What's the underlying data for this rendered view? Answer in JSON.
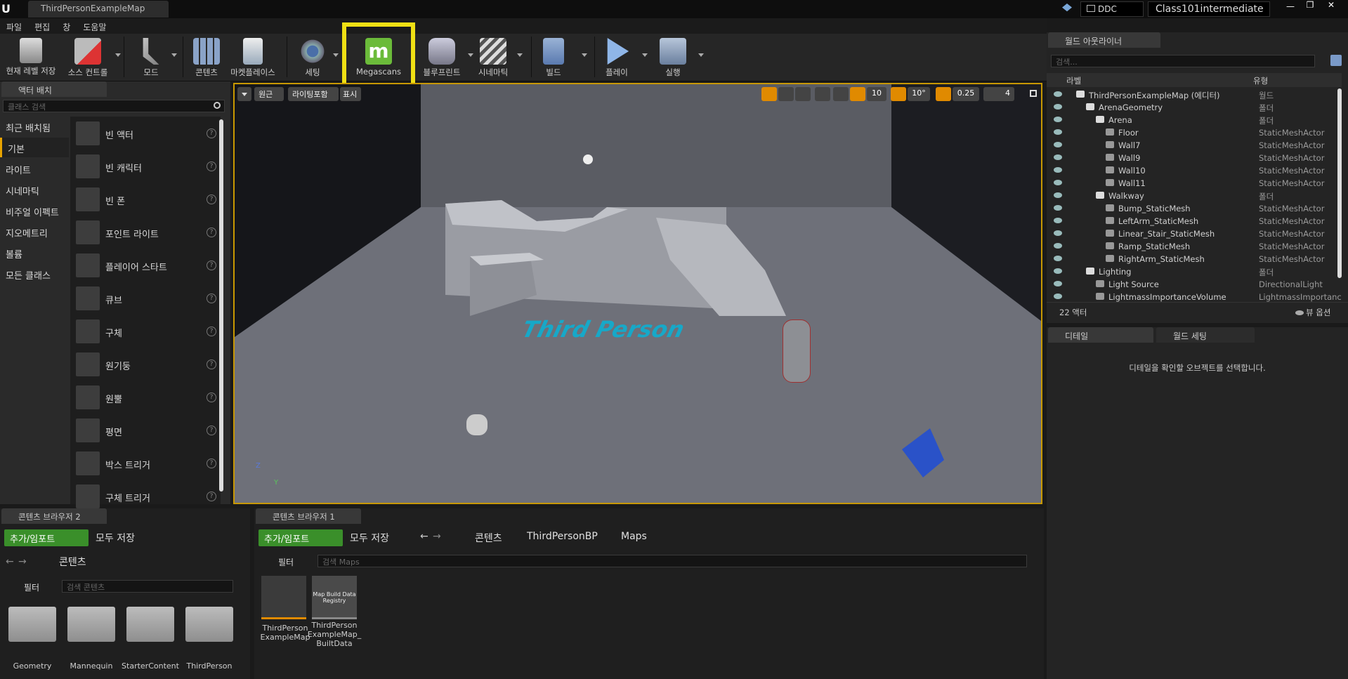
{
  "window": {
    "tab_title": "ThirdPersonExampleMap",
    "ddc_label": "DDC",
    "project_name": "Class101intermediate",
    "controls": [
      "—",
      "❐",
      "✕"
    ]
  },
  "menu": [
    "파일",
    "편집",
    "창",
    "도움말"
  ],
  "toolbar": {
    "items": [
      {
        "label": "현재 레벨 저장",
        "icon": "save-icon"
      },
      {
        "label": "소스 컨트롤",
        "icon": "source-control-icon"
      },
      {
        "label": "모드",
        "icon": "modes-icon"
      },
      {
        "label": "콘텐츠",
        "icon": "content-icon"
      },
      {
        "label": "마켓플레이스",
        "icon": "marketplace-icon"
      },
      {
        "label": "세팅",
        "icon": "settings-icon"
      },
      {
        "label": "Megascans",
        "icon": "megascans-icon"
      },
      {
        "label": "블루프린트",
        "icon": "blueprint-icon"
      },
      {
        "label": "시네마틱",
        "icon": "cinematics-icon"
      },
      {
        "label": "빌드",
        "icon": "build-icon"
      },
      {
        "label": "플레이",
        "icon": "play-icon"
      },
      {
        "label": "실행",
        "icon": "launch-icon"
      }
    ],
    "highlight_color": "#f0e014"
  },
  "place_actors": {
    "tab_label": "액터 배치",
    "search_placeholder": "클래스 검색",
    "categories": [
      "최근 배치됨",
      "기본",
      "라이트",
      "시네마틱",
      "비주얼 이펙트",
      "지오메트리",
      "볼륨",
      "모든 클래스"
    ],
    "selected_category": "기본",
    "items": [
      "빈 액터",
      "빈 캐릭터",
      "빈 폰",
      "포인트 라이트",
      "플레이어 스타트",
      "큐브",
      "구체",
      "원기둥",
      "원뿔",
      "평면",
      "박스 트리거",
      "구체 트리거"
    ]
  },
  "viewport": {
    "perspective_label": "원근",
    "lighting_label": "라이팅포함",
    "show_label": "표시",
    "grid_snap": "10",
    "rotation_snap": "10°",
    "scale_snap": "0.25",
    "camera_speed": "4",
    "floor_text": "Third Person",
    "axis_labels": [
      "Z",
      "Y"
    ],
    "selection_border_color": "#c89800"
  },
  "outliner": {
    "tab_label": "월드 아웃라이너",
    "search_placeholder": "검색...",
    "col_label": "라벨",
    "col_type": "유형",
    "rows": [
      {
        "name": "ThirdPersonExampleMap (에디터)",
        "type": "월드",
        "indent": 0
      },
      {
        "name": "ArenaGeometry",
        "type": "폴더",
        "indent": 1
      },
      {
        "name": "Arena",
        "type": "폴더",
        "indent": 2
      },
      {
        "name": "Floor",
        "type": "StaticMeshActor",
        "indent": 3
      },
      {
        "name": "Wall7",
        "type": "StaticMeshActor",
        "indent": 3
      },
      {
        "name": "Wall9",
        "type": "StaticMeshActor",
        "indent": 3
      },
      {
        "name": "Wall10",
        "type": "StaticMeshActor",
        "indent": 3
      },
      {
        "name": "Wall11",
        "type": "StaticMeshActor",
        "indent": 3
      },
      {
        "name": "Walkway",
        "type": "폴더",
        "indent": 2
      },
      {
        "name": "Bump_StaticMesh",
        "type": "StaticMeshActor",
        "indent": 3
      },
      {
        "name": "LeftArm_StaticMesh",
        "type": "StaticMeshActor",
        "indent": 3
      },
      {
        "name": "Linear_Stair_StaticMesh",
        "type": "StaticMeshActor",
        "indent": 3
      },
      {
        "name": "Ramp_StaticMesh",
        "type": "StaticMeshActor",
        "indent": 3
      },
      {
        "name": "RightArm_StaticMesh",
        "type": "StaticMeshActor",
        "indent": 3
      },
      {
        "name": "Lighting",
        "type": "폴더",
        "indent": 1
      },
      {
        "name": "Light Source",
        "type": "DirectionalLight",
        "indent": 2
      },
      {
        "name": "LightmassImportanceVolume",
        "type": "LightmassImportanc",
        "indent": 2
      }
    ],
    "actor_count": "22 액터",
    "view_options": "뷰 옵션"
  },
  "details": {
    "tab_details": "디테일",
    "tab_world_settings": "월드 세팅",
    "empty_message": "디테일을 확인할 오브젝트를 선택합니다."
  },
  "content_browser_2": {
    "tab_label": "콘텐츠 브라우저 2",
    "add_import": "추가/임포트",
    "save_all": "모두 저장",
    "path": [
      "콘텐츠"
    ],
    "filter_label": "필터",
    "search_placeholder": "검색 콘텐츠",
    "folders": [
      "Geometry",
      "Mannequin",
      "StarterContent",
      "ThirdPerson"
    ]
  },
  "content_browser_1": {
    "tab_label": "콘텐츠 브라우저 1",
    "add_import": "추가/임포트",
    "save_all": "모두 저장",
    "path": [
      "콘텐츠",
      "ThirdPersonBP",
      "Maps"
    ],
    "filter_label": "필터",
    "search_placeholder": "검색 Maps",
    "assets": [
      {
        "label": "ThirdPerson ExampleMap",
        "thumb_text": ""
      },
      {
        "label": "ThirdPerson ExampleMap_ BuiltData",
        "thumb_text": "Map Build Data Registry"
      }
    ]
  }
}
